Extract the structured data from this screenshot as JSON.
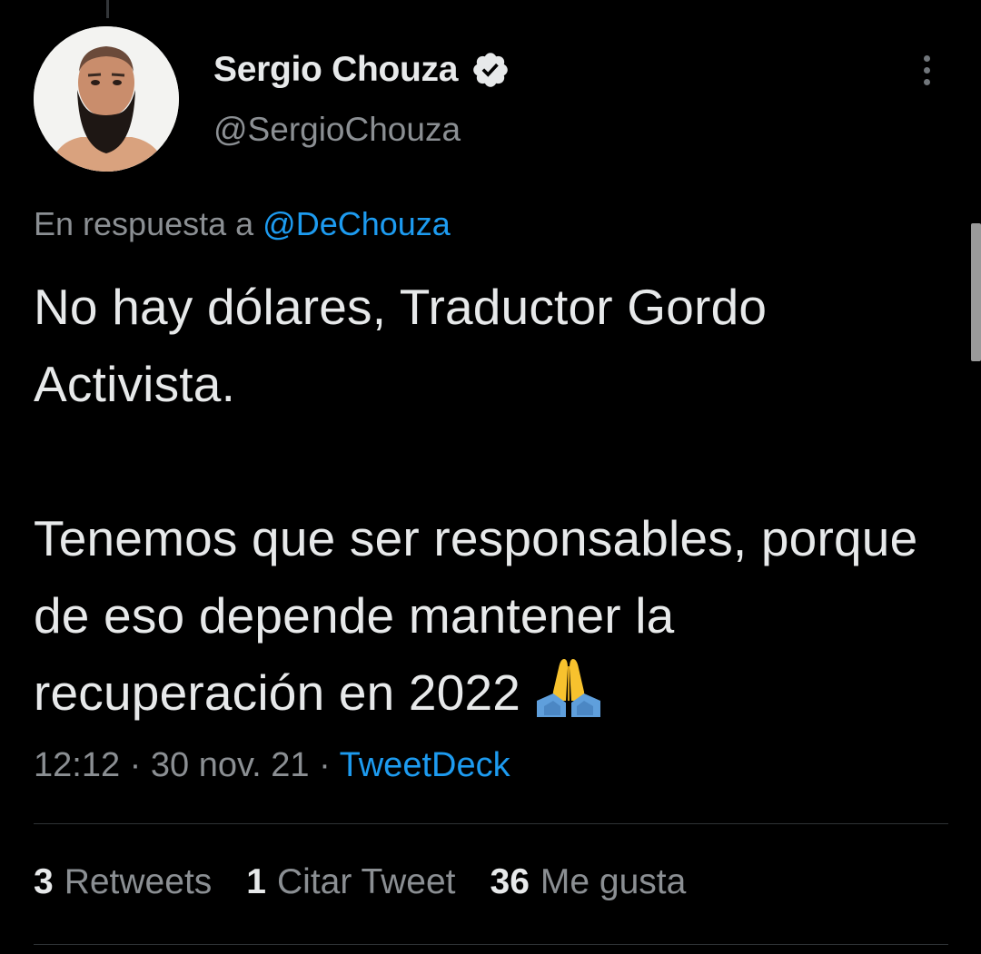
{
  "author": {
    "display_name": "Sergio Chouza",
    "handle": "@SergioChouza",
    "verified": true,
    "avatar_icon": "profile-photo-bearded-man"
  },
  "reply_context": {
    "prefix": "En respuesta a",
    "mention": "@DeChouza"
  },
  "tweet": {
    "text": "No hay dólares, Traductor Gordo Activista.\n\nTenemos que ser responsables, porque de eso depende mantener la recuperación en 2022",
    "emoji": "folded-hands"
  },
  "meta": {
    "time": "12:12",
    "date": "30 nov. 21",
    "separator": "·",
    "source": "TweetDeck"
  },
  "stats": {
    "retweets": {
      "count": "3",
      "label": "Retweets"
    },
    "quotes": {
      "count": "1",
      "label": "Citar Tweet"
    },
    "likes": {
      "count": "36",
      "label": "Me gusta"
    }
  },
  "colors": {
    "background": "#000000",
    "text": "#e7e9ea",
    "muted": "#8b8f93",
    "link": "#1d9bf0",
    "divider": "#2f3336"
  }
}
